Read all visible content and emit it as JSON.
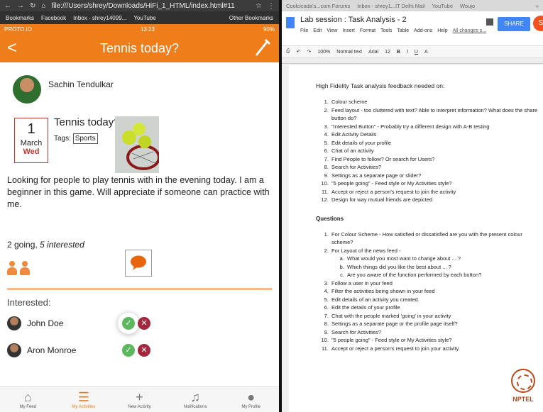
{
  "left_browser": {
    "url": "file:///Users/shrey/Downloads/HiFi_1_HTML/index.html#11",
    "bookmarks": [
      "Bookmarks",
      "Facebook",
      "Inbox - shrey14099...",
      "YouTube"
    ],
    "other_bookmarks": "Other Bookmarks"
  },
  "phone": {
    "status": {
      "carrier": "PROTO.IO",
      "time": "13:23",
      "battery": "90%"
    },
    "appbar": {
      "back": "<",
      "title": "Tennis today?"
    },
    "user": {
      "name": "Sachin Tendulkar"
    },
    "event": {
      "day": "1",
      "month": "March",
      "dow": "Wed",
      "title": "Tennis today?",
      "tags_label": "Tags:",
      "tag": "Sports",
      "description": "Looking for people to play tennis with in the evening today. I am a beginner in this game. Will appreciate if someone can practice with me."
    },
    "going": {
      "count_text": "2 going, ",
      "interested_text": "5 interested"
    },
    "interested": {
      "header": "Interested:",
      "people": [
        {
          "name": "John Doe",
          "accept": "✓",
          "reject": "✕"
        },
        {
          "name": "Aron Monroe",
          "accept": "✓",
          "reject": "✕"
        }
      ]
    },
    "nav": [
      {
        "label": "My Feed",
        "icon": "home-icon",
        "glyph": "⌂"
      },
      {
        "label": "My Activities",
        "icon": "list-icon",
        "glyph": "☰"
      },
      {
        "label": "New Activity",
        "icon": "plus-icon",
        "glyph": "+"
      },
      {
        "label": "Notifications",
        "icon": "bell-icon",
        "glyph": "♫"
      },
      {
        "label": "My Profile",
        "icon": "person-icon",
        "glyph": "●"
      }
    ],
    "accent": "#ef7d1a"
  },
  "right_browser": {
    "tabs": [
      "Coolcicada's...com Forums",
      "Inbox - shrey1...IT Delhi Mail",
      "YouTube",
      "Woujo"
    ],
    "doc": {
      "title": "Lab session : Task Analysis - 2",
      "menu": [
        "File",
        "Edit",
        "View",
        "Insert",
        "Format",
        "Tools",
        "Table",
        "Add-ons",
        "Help"
      ],
      "changes": "All changes s...",
      "share": "SHARE",
      "account": "S",
      "toolbar": [
        "100%",
        "Normal text",
        "Arial",
        "12",
        "B",
        "I",
        "U",
        "A"
      ],
      "intro": "High Fidelity Task analysis feedback needed on:",
      "feedback_items": [
        "Colour scheme",
        "Feed layout - too cluttered with text? Able to interpret information? What does the share button do?",
        "\"Interested Button\" - Probably try a different design with A-B testing",
        "Edit Activity Details",
        "Edit details of your profile",
        "Chat of an activity",
        "Find People to follow? Or search for Users?",
        "Search for Activities?",
        "Settings as a separate page or slider?",
        "\"5 people going\" - Feed style or My Activities style?",
        "Accept or reject a person's request to join the activity",
        "Design for way mutual friends are depicted"
      ],
      "questions_header": "Questions",
      "questions": [
        "For Colour Scheme - How satisfied or dissatisfied are you with the present colour scheme?",
        "For Layout of the news feed -",
        "Follow a user in your feed",
        "Filter the activities being shown in your feed",
        "Edit details of an activity you created.",
        "Edit the details of your profile",
        "Chat with the people marked 'going' in your activity",
        "Settings as a separate page or the profile page itself?",
        "Search for Activities?",
        "\"5 people going\" - Feed style or My Activities style?",
        "Accept or reject a person's request to join your activity"
      ],
      "subquestions": [
        "What would you most want to change about ... ?",
        "Which things did you like the best about ... ?",
        "Are you aware of the function performed by each button?"
      ]
    },
    "nptel": "NPTEL"
  }
}
